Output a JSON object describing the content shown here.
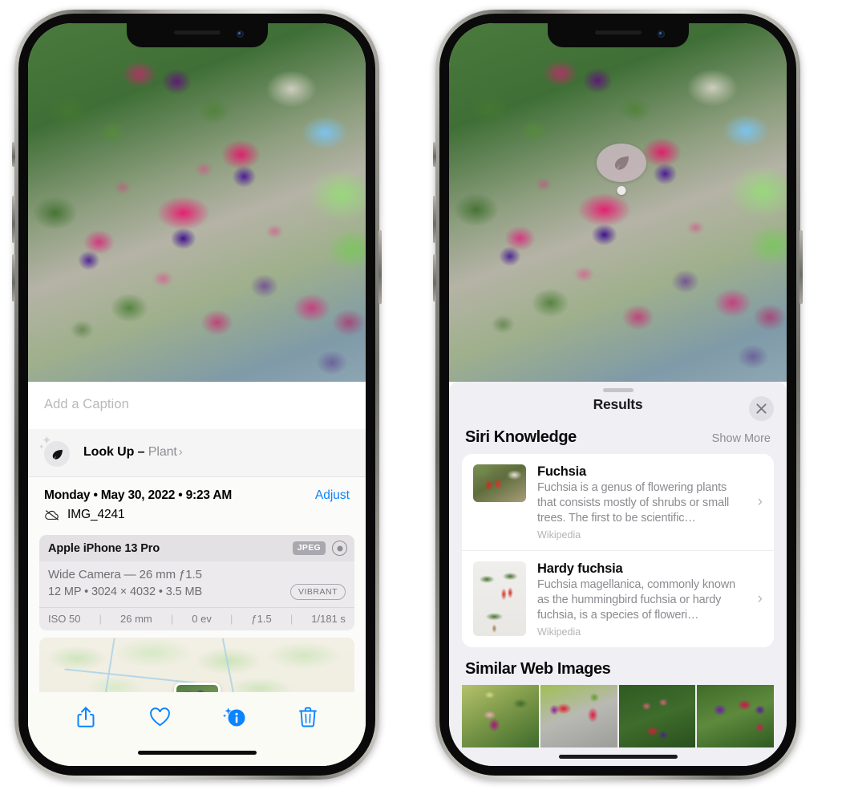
{
  "left_phone": {
    "caption_placeholder": "Add a Caption",
    "lookup": {
      "label": "Look Up",
      "dash": " – ",
      "subject": "Plant",
      "chevron": "›",
      "icon": "leaf-icon"
    },
    "meta": {
      "date": "Monday • May 30, 2022 • 9:23 AM",
      "adjust_label": "Adjust",
      "filename": "IMG_4241",
      "cloud_icon": "icloud-slash-icon"
    },
    "camera_card": {
      "model": "Apple iPhone 13 Pro",
      "format_badge": "JPEG",
      "hdr_icon": "hdr-circle-icon",
      "lens_line": "Wide Camera — 26 mm ƒ1.5",
      "size_line": "12 MP • 3024 × 4032 • 3.5 MB",
      "style_badge": "VIBRANT",
      "exif": [
        "ISO 50",
        "26 mm",
        "0 ev",
        "ƒ1.5",
        "1/181 s"
      ]
    },
    "toolbar": [
      {
        "name": "share-icon",
        "label": "Share"
      },
      {
        "name": "heart-icon",
        "label": "Favorite"
      },
      {
        "name": "info-icon",
        "label": "Info"
      },
      {
        "name": "trash-icon",
        "label": "Delete"
      }
    ]
  },
  "right_phone": {
    "marker": {
      "icon": "leaf-icon"
    },
    "sheet": {
      "title": "Results",
      "close_icon": "close-icon",
      "sections": [
        {
          "title": "Siri Knowledge",
          "action": "Show More",
          "items": [
            {
              "title": "Fuchsia",
              "description": "Fuchsia is a genus of flowering plants that consists mostly of shrubs or small trees. The first to be scientific…",
              "source": "Wikipedia",
              "chevron": "›"
            },
            {
              "title": "Hardy fuchsia",
              "description": "Fuchsia magellanica, commonly known as the hummingbird fuchsia or hardy fuchsia, is a species of floweri…",
              "source": "Wikipedia",
              "chevron": "›"
            }
          ]
        },
        {
          "title": "Similar Web Images",
          "action": "",
          "images": [
            "web-image-1",
            "web-image-2",
            "web-image-3",
            "web-image-4"
          ]
        }
      ]
    }
  },
  "colors": {
    "accent_blue": "#0a84ff",
    "sheet_bg": "#f0eff4",
    "card_bg": "#ffffff",
    "secondary_text": "#8b8b91"
  }
}
